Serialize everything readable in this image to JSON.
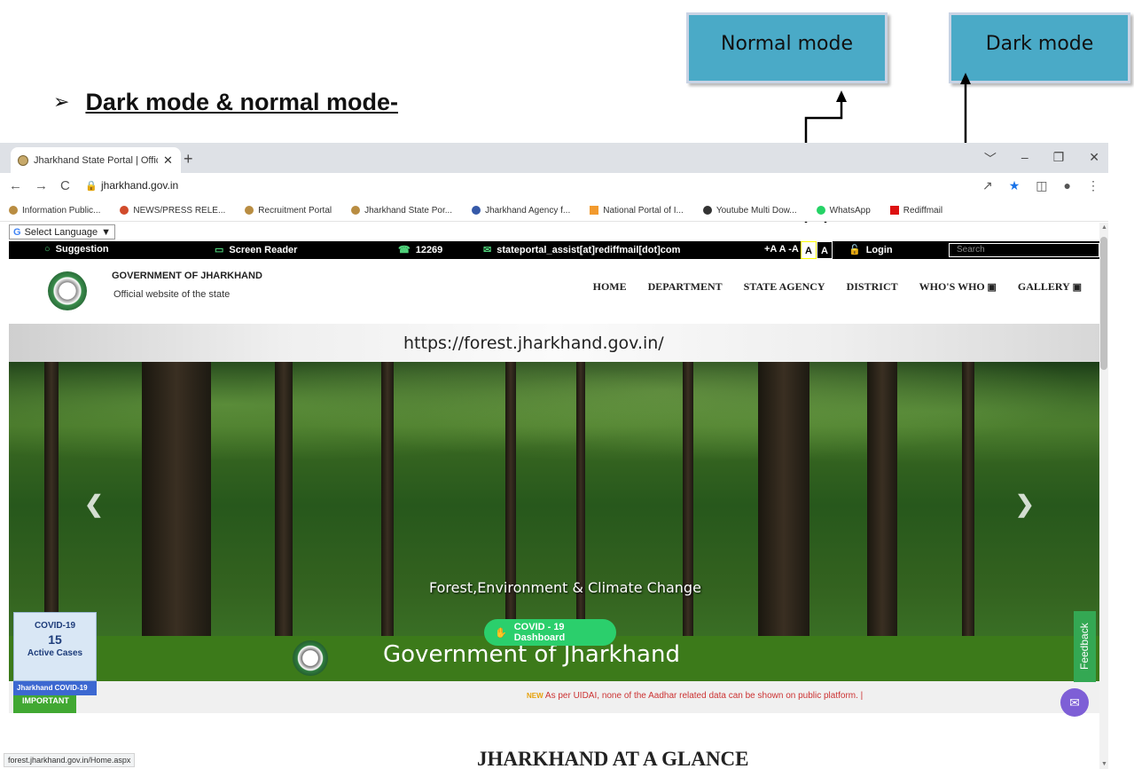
{
  "annotation": {
    "heading_bullet": "➢",
    "heading": "Dark mode & normal mode-",
    "callout_normal": "Normal mode",
    "callout_dark": "Dark mode"
  },
  "browser": {
    "tab_title": "Jharkhand State Portal | Official V",
    "tab_close": "✕",
    "new_tab": "+",
    "url": "jharkhand.gov.in",
    "nav_back": "←",
    "nav_forward": "→",
    "nav_reload": "C",
    "window_controls": [
      "﹀",
      "–",
      "❐",
      "✕"
    ],
    "bookmarks": [
      "Information Public...",
      "NEWS/PRESS RELE...",
      "Recruitment Portal",
      "Jharkhand State Por...",
      "Jharkhand Agency f...",
      "National Portal of I...",
      "Youtube Multi Dow...",
      "WhatsApp",
      "Rediffmail"
    ]
  },
  "site": {
    "language_select": "Select Language",
    "language_caret": "▼",
    "topbar": {
      "suggestion": "Suggestion",
      "screen_reader": "Screen Reader",
      "helpline": "12269",
      "email": "stateportal_assist[at]rediffmail[dot]com",
      "font_sizes": "+A A -A",
      "normal_mode_btn": "A",
      "dark_mode_btn": "A",
      "login": "Login",
      "search_placeholder": "Search"
    },
    "header": {
      "gov_name": "GOVERNMENT OF JHARKHAND",
      "gov_sub": "Official website of the state",
      "menu": [
        "HOME",
        "DEPARTMENT",
        "STATE AGENCY",
        "DISTRICT",
        "WHO'S WHO",
        "GALLERY"
      ]
    },
    "banner_url": "https://forest.jharkhand.gov.in/",
    "slide_caption": "Forest,Environment & Climate Change",
    "band_title": "Government of Jharkhand",
    "covid_pill": "COVID - 19 Dashboard",
    "covid": {
      "title": "COVID-19",
      "count": "15",
      "label": "Active Cases",
      "tag": "Jharkhand COVID-19"
    },
    "ticker_label": "IMPORTANT",
    "ticker_new": "NEW",
    "ticker_text": "As per UIDAI, none of the Aadhar related data can be shown on public platform.  |",
    "feedback": "Feedback",
    "status_url": "forest.jharkhand.gov.in/Home.aspx",
    "glance_heading": "JHARKHAND AT A GLANCE"
  }
}
